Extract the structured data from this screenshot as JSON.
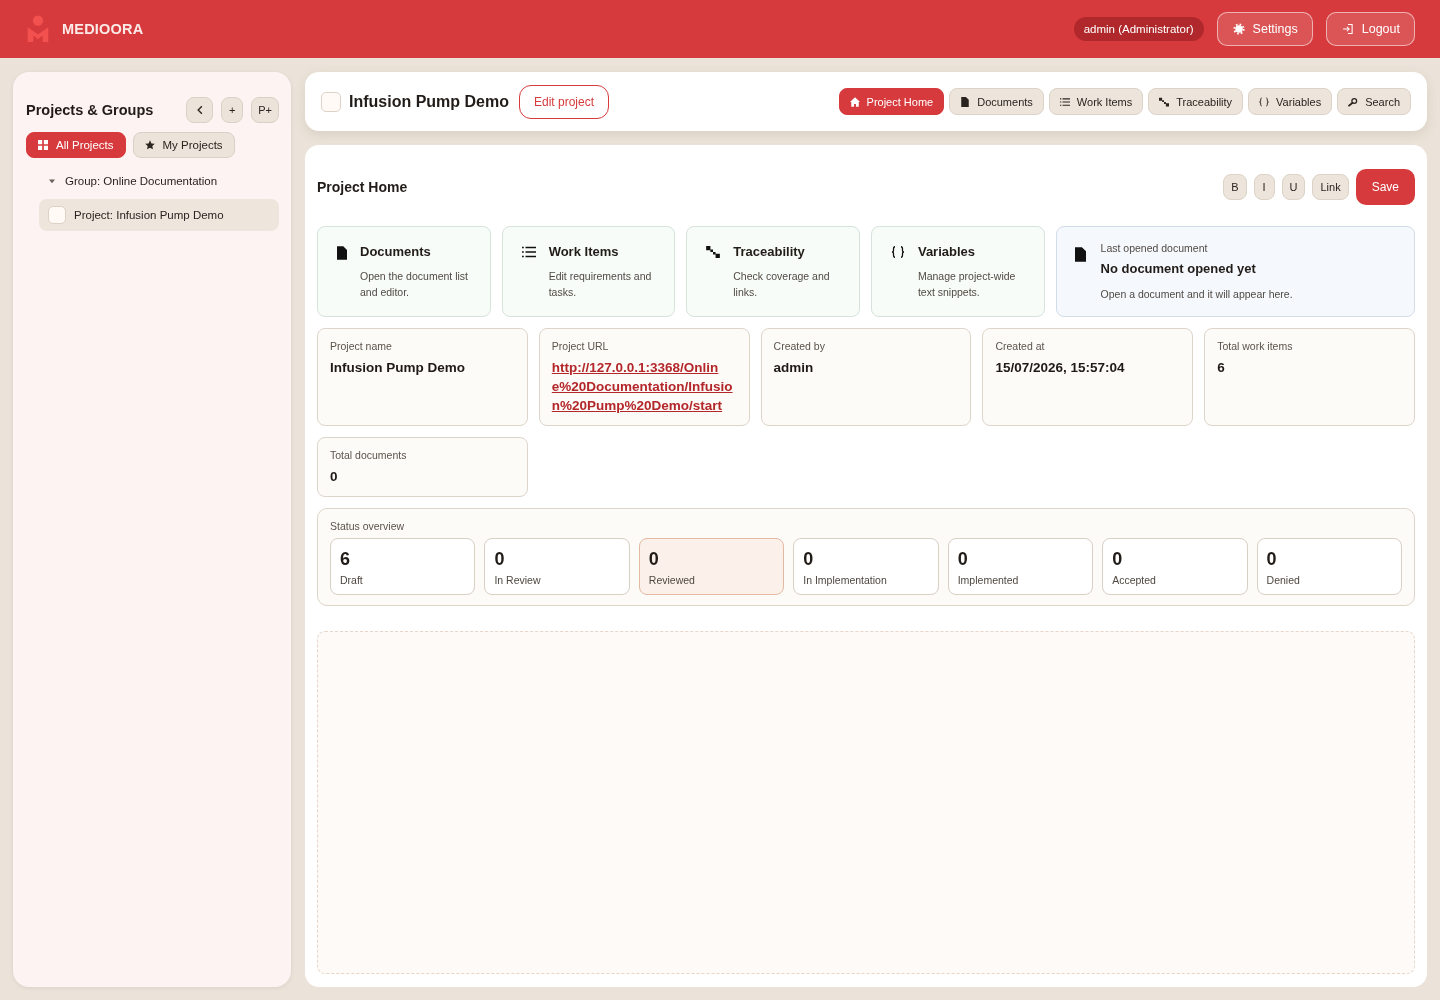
{
  "header": {
    "brand": "MEDIOORA",
    "user_badge": "admin (Administrator)",
    "buttons": [
      "Settings",
      "Logout"
    ]
  },
  "sidebar": {
    "title": "Projects & Groups",
    "tool_buttons": [
      "+",
      "P+"
    ],
    "filters": [
      {
        "label": "All Projects",
        "selected": true
      },
      {
        "label": "My Projects",
        "selected": false
      }
    ],
    "tree": [
      {
        "label": "Group: Online Documentation",
        "expanded": true,
        "children": [
          {
            "label": "Project: Infusion Pump Demo",
            "selected": true,
            "checked": false
          }
        ]
      }
    ]
  },
  "project_bar": {
    "checked": false,
    "title": "Infusion Pump Demo",
    "edit_button": "Edit project",
    "tabs": [
      {
        "label": "Project Home",
        "selected": true
      },
      {
        "label": "Documents",
        "selected": false
      },
      {
        "label": "Work Items",
        "selected": false
      },
      {
        "label": "Traceability",
        "selected": false
      },
      {
        "label": "Variables",
        "selected": false
      },
      {
        "label": "Search",
        "selected": false
      }
    ]
  },
  "panel": {
    "title": "Project Home",
    "format_buttons": [
      "B",
      "I",
      "U",
      "Link"
    ],
    "save_button": "Save",
    "quick_links": [
      {
        "title": "Documents",
        "description": "Open the document list and editor."
      },
      {
        "title": "Work Items",
        "description": "Edit requirements and tasks."
      },
      {
        "title": "Traceability",
        "description": "Check coverage and links."
      },
      {
        "title": "Variables",
        "description": "Manage project-wide text snippets."
      }
    ],
    "last_opened": {
      "label": "Last opened document",
      "title": "No document opened yet",
      "description": "Open a document and it will appear here."
    },
    "details": [
      {
        "label": "Project name",
        "value": "Infusion Pump Demo",
        "kind": "text"
      },
      {
        "label": "Project URL",
        "value": "http://127.0.0.1:3368/Online%20Documentation/Infusion%20Pump%20Demo/start",
        "kind": "link"
      },
      {
        "label": "Created by",
        "value": "admin",
        "kind": "text"
      },
      {
        "label": "Created at",
        "value": "15/07/2026, 15:57:04",
        "kind": "text"
      },
      {
        "label": "Total work items",
        "value": "6",
        "kind": "text"
      },
      {
        "label": "Total documents",
        "value": "0",
        "kind": "text"
      }
    ],
    "status_overview": {
      "label": "Status overview",
      "items": [
        {
          "count": "6",
          "label": "Draft",
          "selected": false
        },
        {
          "count": "0",
          "label": "In Review",
          "selected": false
        },
        {
          "count": "0",
          "label": "Reviewed",
          "selected": true
        },
        {
          "count": "0",
          "label": "In Implementation",
          "selected": false
        },
        {
          "count": "0",
          "label": "Implemented",
          "selected": false
        },
        {
          "count": "0",
          "label": "Accepted",
          "selected": false
        },
        {
          "count": "0",
          "label": "Denied",
          "selected": false
        }
      ]
    }
  }
}
